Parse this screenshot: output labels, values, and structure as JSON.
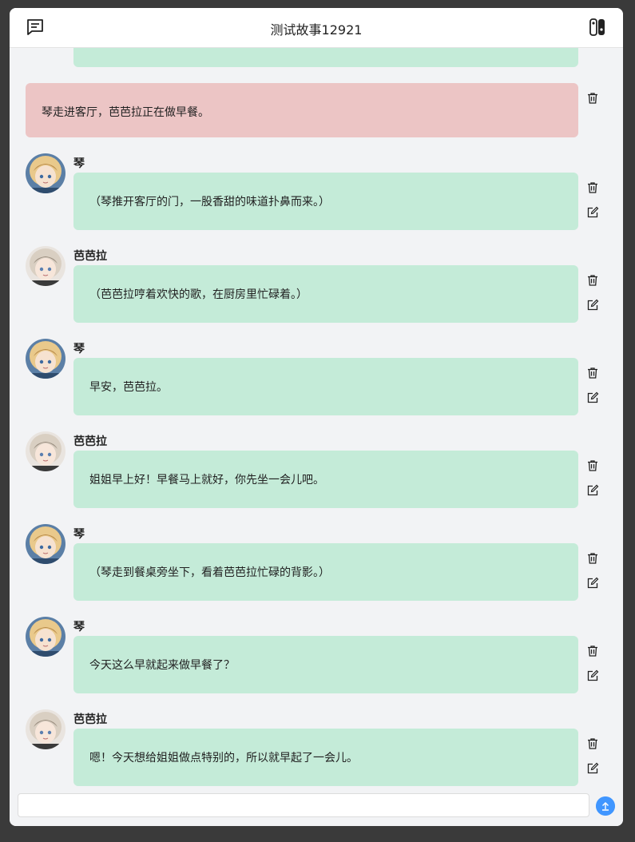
{
  "header": {
    "title": "测试故事12921",
    "left_icon": "chat-list-icon",
    "right_icon": "switch-console-icon"
  },
  "narration": {
    "text": "琴走进客厅，芭芭拉正在做早餐。"
  },
  "colors": {
    "bubble": "#c4ebd8",
    "narration": "#ecc5c5",
    "send": "#4096ff",
    "background": "#f2f3f5"
  },
  "messages": [
    {
      "speaker": "琴",
      "text": "（琴推开客厅的门，一股香甜的味道扑鼻而来。）"
    },
    {
      "speaker": "芭芭拉",
      "text": "（芭芭拉哼着欢快的歌，在厨房里忙碌着。）"
    },
    {
      "speaker": "琴",
      "text": "早安，芭芭拉。"
    },
    {
      "speaker": "芭芭拉",
      "text": "姐姐早上好！早餐马上就好，你先坐一会儿吧。"
    },
    {
      "speaker": "琴",
      "text": "（琴走到餐桌旁坐下，看着芭芭拉忙碌的背影。）"
    },
    {
      "speaker": "琴",
      "text": "今天这么早就起来做早餐了？"
    },
    {
      "speaker": "芭芭拉",
      "text": "嗯！今天想给姐姐做点特别的，所以就早起了一会儿。"
    }
  ],
  "input": {
    "value": "",
    "placeholder": ""
  }
}
